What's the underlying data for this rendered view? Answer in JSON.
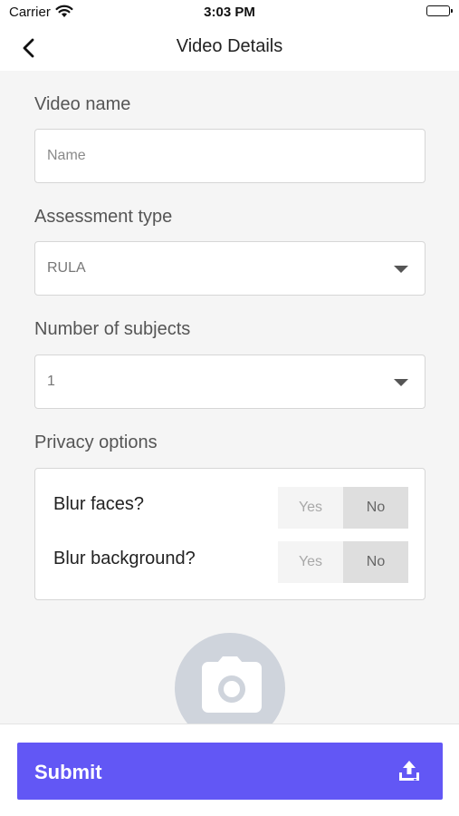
{
  "status_bar": {
    "carrier": "Carrier",
    "time": "3:03 PM"
  },
  "nav": {
    "title": "Video Details",
    "back_icon": "chevron-left-icon"
  },
  "form": {
    "video_name": {
      "label": "Video name",
      "placeholder": "Name",
      "value": ""
    },
    "assessment_type": {
      "label": "Assessment type",
      "value": "RULA"
    },
    "subjects": {
      "label": "Number of subjects",
      "value": "1"
    },
    "privacy": {
      "label": "Privacy options",
      "blur_faces": {
        "label": "Blur faces?",
        "yes": "Yes",
        "no": "No",
        "selected": "No"
      },
      "blur_background": {
        "label": "Blur background?",
        "yes": "Yes",
        "no": "No",
        "selected": "No"
      }
    }
  },
  "camera_icon": "camera-icon",
  "submit": {
    "label": "Submit",
    "icon": "upload-icon",
    "color": "#6257f5"
  }
}
